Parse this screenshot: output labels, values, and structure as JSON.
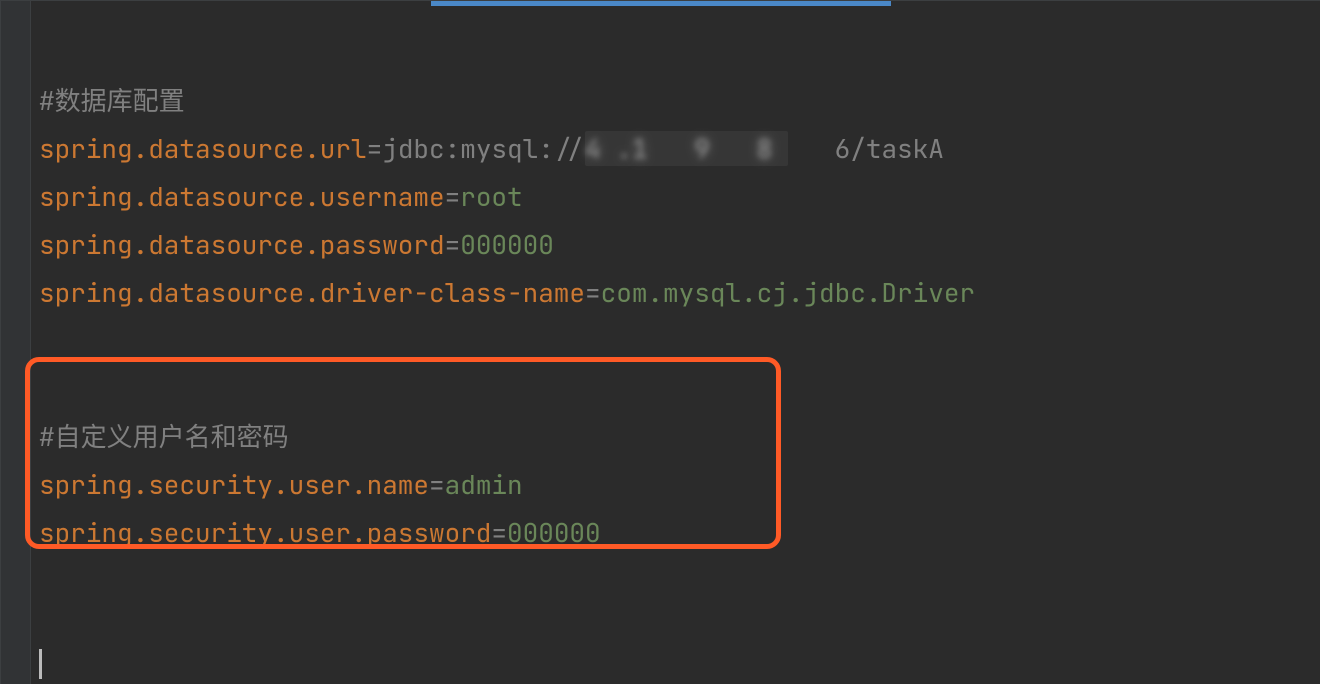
{
  "lines": {
    "l1_comment": "#数据库配置",
    "l2_key": "spring.datasource.url",
    "l2_eq": "=",
    "l2_prefix": "jdbc:mysql://",
    "l2_redacted": "4 .1   9   8 ",
    "l2_suffix": "   6/taskA",
    "l3_key": "spring.datasource.username",
    "l3_eq": "=",
    "l3_val": "root",
    "l4_key": "spring.datasource.password",
    "l4_eq": "=",
    "l4_val": "000000",
    "l5_key": "spring.datasource.driver-class-name",
    "l5_eq": "=",
    "l5_val": "com.mysql.cj.jdbc.Driver",
    "l8_comment": "#自定义用户名和密码",
    "l9_key": "spring.security.user.name",
    "l9_eq": "=",
    "l9_val": "admin",
    "l10_key": "spring.security.user.password",
    "l10_eq": "=",
    "l10_val": "000000"
  }
}
